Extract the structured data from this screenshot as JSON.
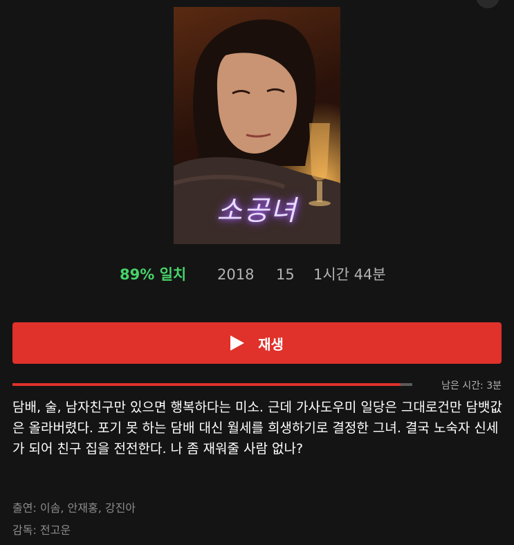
{
  "poster": {
    "title_art": "소공녀"
  },
  "meta": {
    "match": "89% 일치",
    "year": "2018",
    "rating": "15",
    "duration": "1시간 44분"
  },
  "play_button": {
    "label": "재생",
    "icon": "play-icon"
  },
  "progress": {
    "watched_fraction": 0.97,
    "remaining_text": "남은 시간: 3분"
  },
  "synopsis": "담배, 술, 남자친구만 있으면 행복하다는 미소. 근데 가사도우미 일당은 그대로건만 담뱃값은 올라버렸다. 포기 못 하는 담배 대신 월세를 희생하기로 결정한 그녀. 결국 노숙자 신세가 되어 친구 집을 전전한다. 나 좀 재워줄 사람 없나?",
  "credits": {
    "cast": "출연: 이솜, 안재홍, 강진아",
    "director": "감독: 전고운"
  },
  "colors": {
    "background": "#141414",
    "accent_red": "#e0312b",
    "match_green": "#46d369",
    "muted_text": "#b3b3b3"
  }
}
